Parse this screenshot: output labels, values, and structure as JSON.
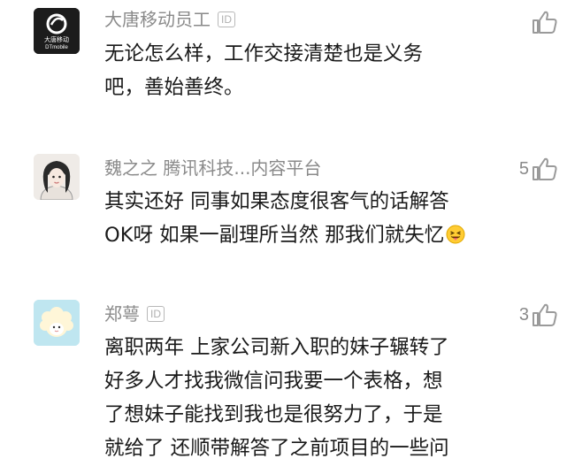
{
  "comments": [
    {
      "username": "大唐移动员工",
      "has_id_badge": true,
      "id_badge": "ID",
      "avatar_logo_text": "大唐移动",
      "avatar_logo_sub": "DTmobile",
      "lines": [
        "无论怎么样，工作交接清楚也是义务",
        "吧，善始善终。"
      ],
      "likes": ""
    },
    {
      "username": "魏之之 腾讯科技...内容平台",
      "has_id_badge": false,
      "lines": [
        "其实还好 同事如果态度很客气的话解答",
        "OK呀 如果一副理所当然 那我们就失忆"
      ],
      "likes": "5"
    },
    {
      "username": "郑萼",
      "has_id_badge": true,
      "id_badge": "ID",
      "lines": [
        "离职两年 上家公司新入职的妹子辗转了",
        "好多人才找我微信问我要一个表格，想",
        "了想妹子能找到我也是很努力了，于是",
        "就给了 还顺带解答了之前项目的一些问"
      ],
      "likes": "3"
    }
  ],
  "colors": {
    "username": "#8a8a8a",
    "body_text": "#1a1a1a",
    "icon": "#9a9a9a",
    "avatar1_bg": "#1c1c1c",
    "avatar3_bg": "#bfe6f0"
  },
  "icons": {
    "like": "thumbs-up-outline-icon",
    "emoji": "tongue-out-face-emoji"
  }
}
